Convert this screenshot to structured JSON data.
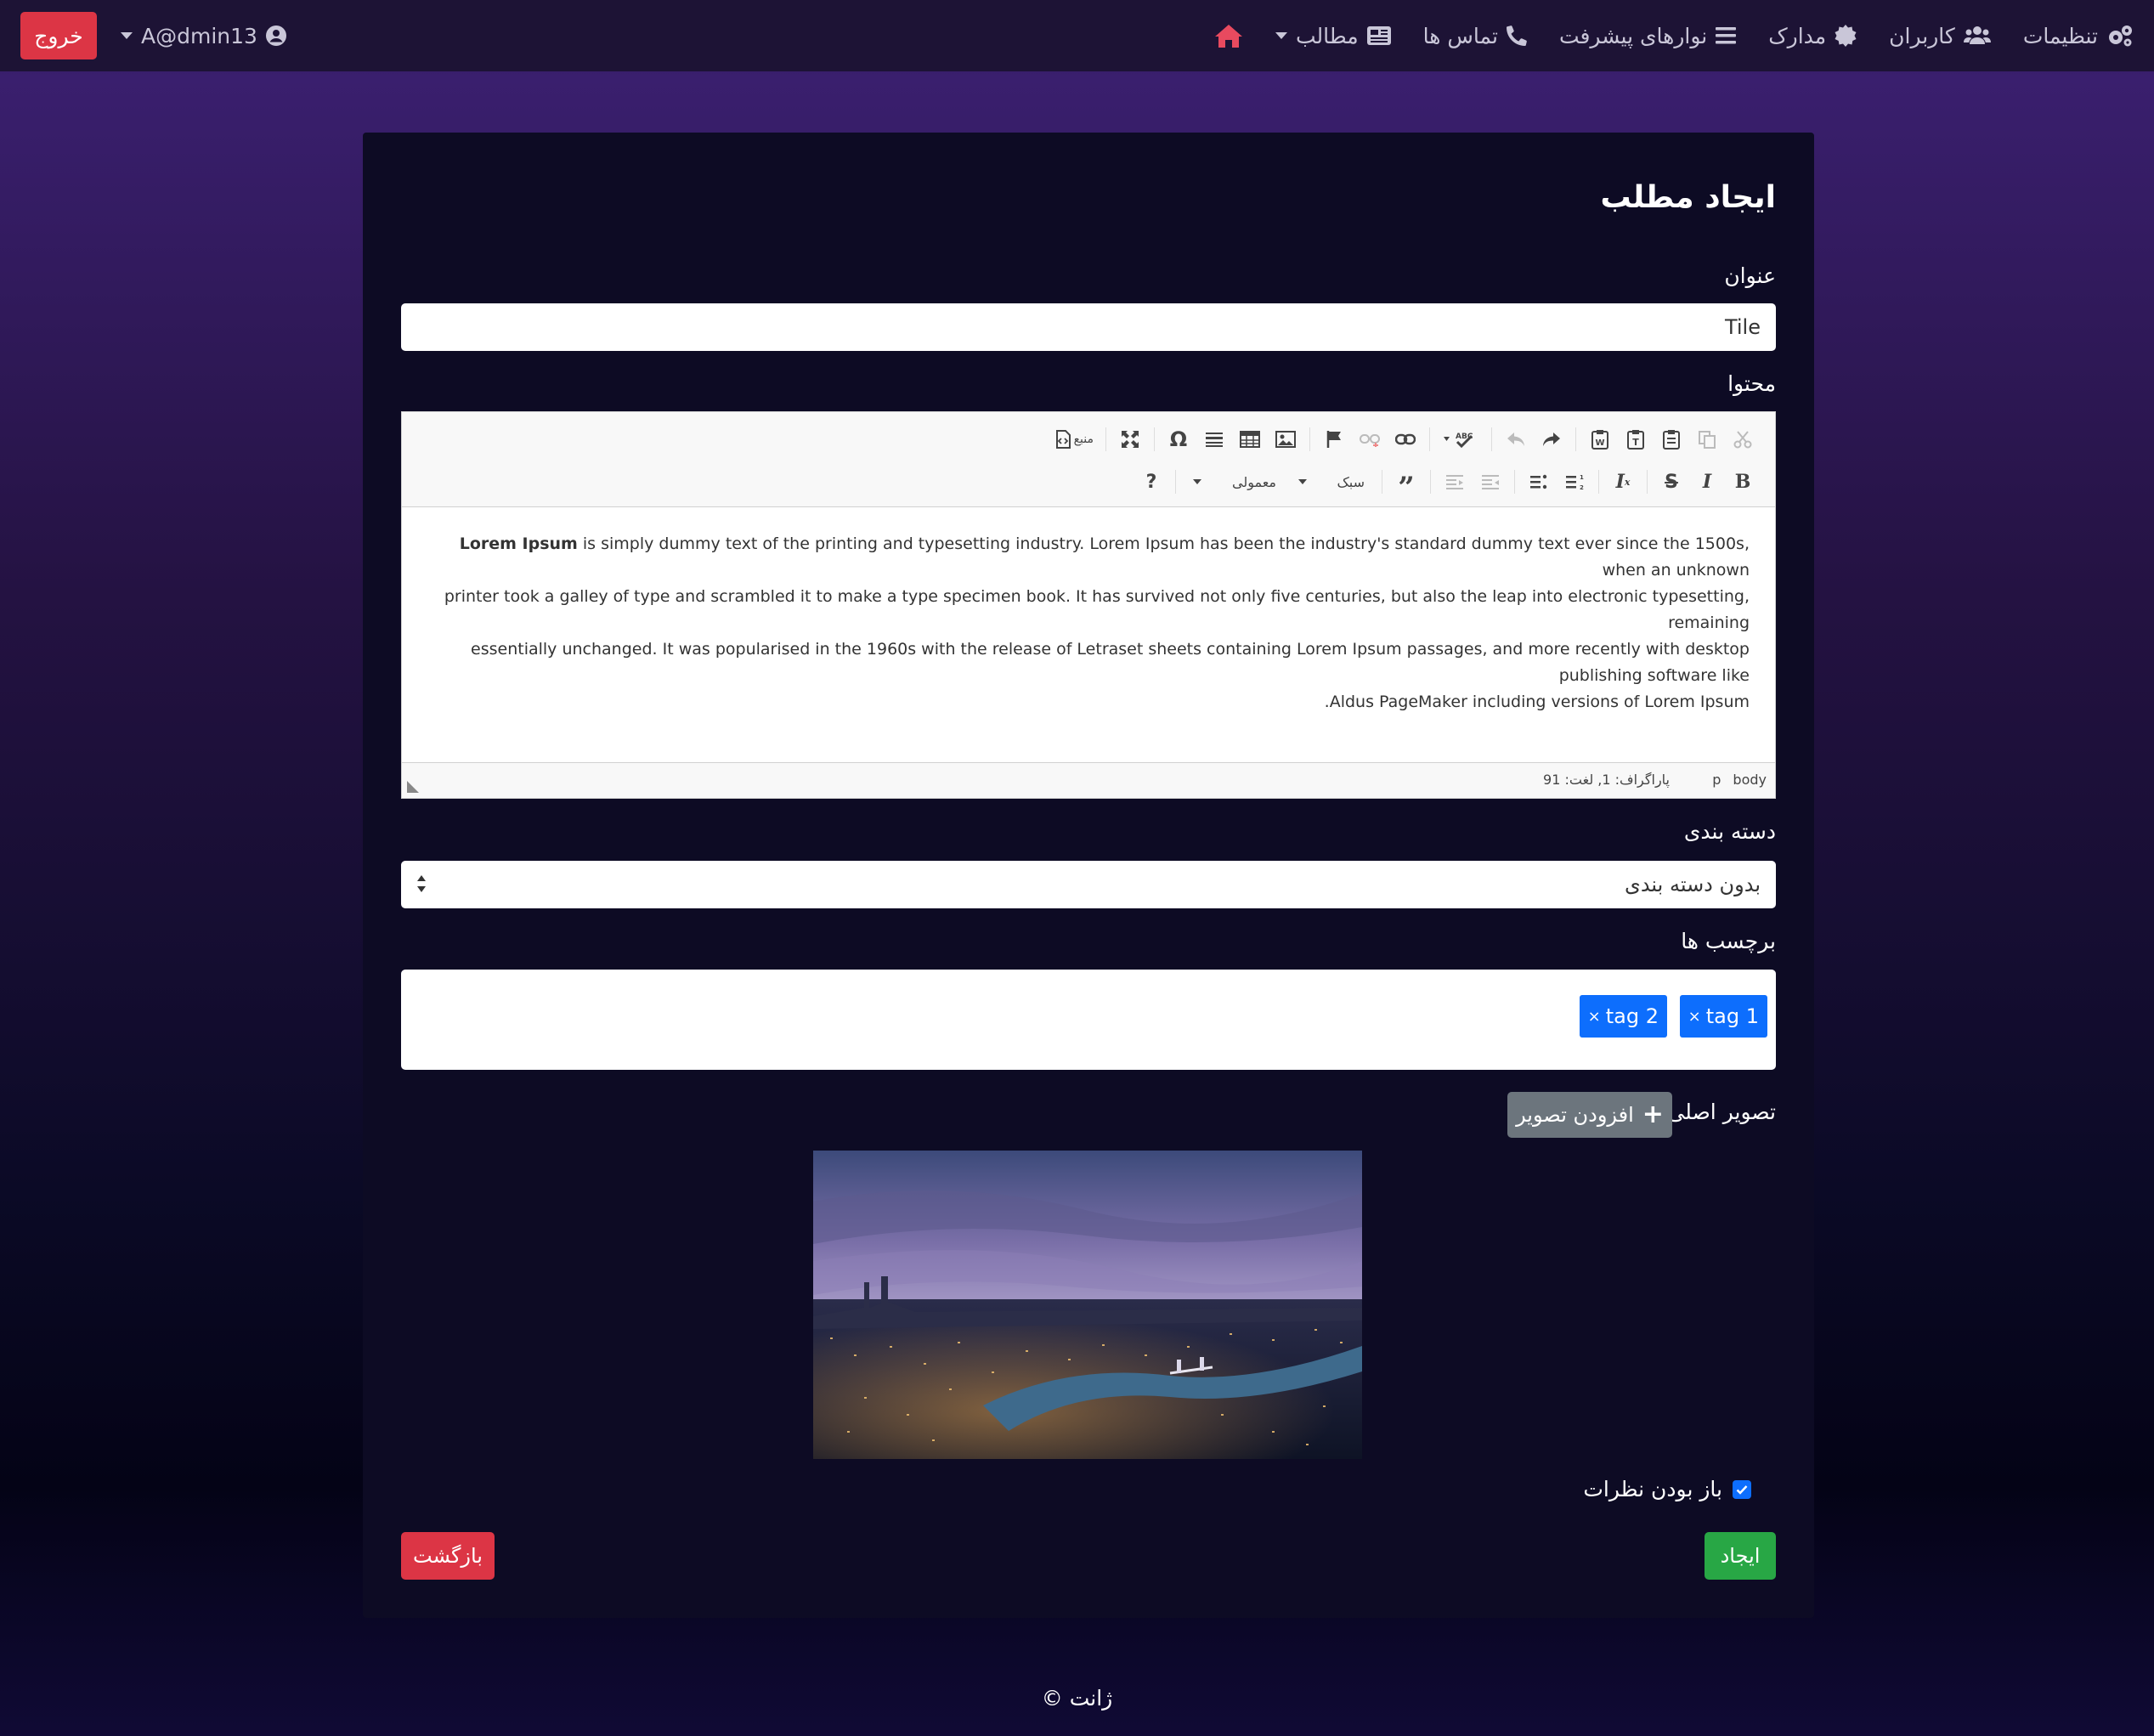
{
  "navbar": {
    "items": [
      {
        "label": "مطالب",
        "icon": "newspaper-icon",
        "dropdown": true
      },
      {
        "label": "تماس ها",
        "icon": "phone-icon"
      },
      {
        "label": "نوارهای پیشرفت",
        "icon": "bars-icon"
      },
      {
        "label": "مدارک",
        "icon": "certificate-icon"
      },
      {
        "label": "کاربران",
        "icon": "users-icon"
      },
      {
        "label": "تنظیمات",
        "icon": "gears-icon"
      }
    ],
    "user": "A@dmin13",
    "logout_label": "خروج",
    "accent": "#e84a5f"
  },
  "page": {
    "title": "ایجاد مطلب",
    "title_label": "عنوان",
    "title_value": "Tile",
    "content_label": "محتوا",
    "category_label": "دسته بندی",
    "category_value": "بدون دسته بندی",
    "tags_label": "برچسب ها",
    "tags": [
      "1 tag",
      "2 tag"
    ],
    "main_image_label": "تصویر اصلی",
    "add_image_label": "افزودن تصویر",
    "comments_label": "باز بودن نظرات",
    "comments_checked": true,
    "create_label": "ایجاد",
    "back_label": "بازگشت"
  },
  "editor": {
    "source_label": "منبع",
    "style_label": "سبک",
    "format_label": "معمولی",
    "help_label": "?",
    "content_bold": "Lorem Ipsum",
    "content_lines": [
      " is simply dummy text of the printing and typesetting industry. Lorem Ipsum has been the industry's standard dummy text ever since the 1500s, when an unknown",
      "printer took a galley of type and scrambled it to make a type specimen book. It has survived not only five centuries, but also the leap into electronic typesetting, remaining",
      "essentially unchanged. It was popularised in the 1960s with the release of Letraset sheets containing Lorem Ipsum passages, and more recently with desktop publishing software like",
      ".Aldus PageMaker including versions of Lorem Ipsum"
    ],
    "path_body": "body",
    "path_p": "p",
    "word_count": "پاراگراف: 1, لغت: 91"
  },
  "footer": {
    "text": "ژانت ©"
  },
  "colors": {
    "primary": "#0d6efd",
    "success": "#28a745",
    "danger": "#dc3545",
    "secondary": "#6c757d"
  }
}
